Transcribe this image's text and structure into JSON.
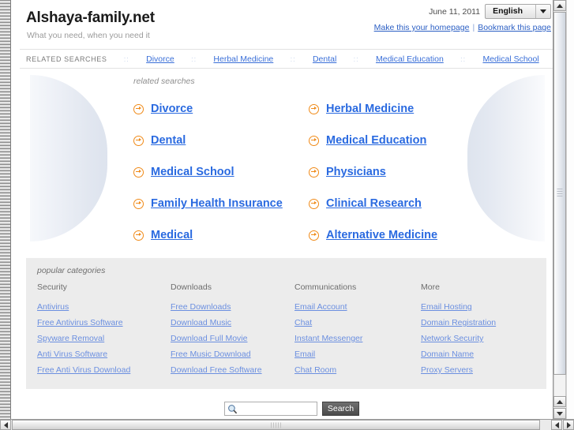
{
  "header": {
    "site_title": "Alshaya-family.net",
    "tagline": "What you need, when you need it",
    "date": "June 11, 2011",
    "language": "English",
    "homepage_link": "Make this your homepage",
    "bookmark_link": "Bookmark this page",
    "link_separator": "|"
  },
  "related_searches_bar": {
    "label": "RELATED SEARCHES",
    "separator": "::",
    "items": [
      "Divorce",
      "Herbal Medicine",
      "Dental",
      "Medical Education",
      "Medical School"
    ]
  },
  "hero": {
    "label": "related searches",
    "items": [
      "Divorce",
      "Herbal Medicine",
      "Dental",
      "Medical Education",
      "Medical School",
      "Physicians",
      "Family Health Insurance",
      "Clinical Research",
      "Medical",
      "Alternative Medicine"
    ]
  },
  "popular_categories": {
    "label": "popular categories",
    "columns": [
      {
        "heading": "Security",
        "links": [
          "Antivirus",
          "Free Antivirus Software",
          "Spyware Removal",
          "Anti Virus Software",
          "Free Anti Virus Download"
        ]
      },
      {
        "heading": "Downloads",
        "links": [
          "Free Downloads",
          "Download Music",
          "Download Full Movie",
          "Free Music Download",
          "Download Free Software"
        ]
      },
      {
        "heading": "Communications",
        "links": [
          "Email Account",
          "Chat",
          "Instant Messenger",
          "Email",
          "Chat Room"
        ]
      },
      {
        "heading": "More",
        "links": [
          "Email Hosting",
          "Domain Registration",
          "Network Security",
          "Domain Name",
          "Proxy Servers"
        ]
      }
    ]
  },
  "search": {
    "value": "",
    "placeholder": "",
    "button_label": "Search",
    "icon": "magnifier-icon"
  },
  "colors": {
    "link_blue": "#2a6ae0",
    "nav_link_blue": "#3a6fd8",
    "category_link_blue": "#6b8fe0",
    "accent_orange": "#f08a18",
    "panel_gray": "#ececec",
    "button_dark": "#4a4a4a"
  }
}
